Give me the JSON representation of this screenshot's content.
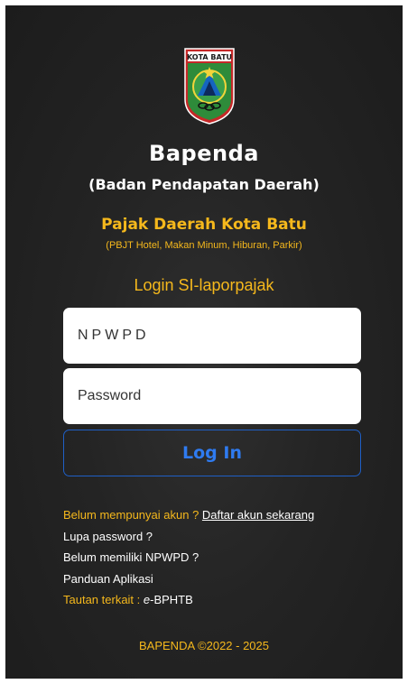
{
  "logo": {
    "text": "KOTA BATU"
  },
  "header": {
    "title": "Bapenda",
    "subtitle": "(Badan Pendapatan Daerah)",
    "tax_title": "Pajak Daerah Kota Batu",
    "tax_subtitle": "(PBJT Hotel, Makan Minum, Hiburan, Parkir)",
    "login_title": "Login SI-laporpajak"
  },
  "form": {
    "npwpd_placeholder": "NPWPD",
    "password_placeholder": "Password",
    "login_label": "Log In"
  },
  "links": {
    "no_account": "Belum mempunyai akun ? ",
    "register": "Daftar akun sekarang",
    "forgot": "Lupa password ?",
    "no_npwpd": "Belum memiliki NPWPD ?",
    "guide": "Panduan Aplikasi",
    "related_label": "Tautan terkait : ",
    "bphtb_prefix": "e",
    "bphtb_suffix": "-BPHTB"
  },
  "footer": {
    "copyright": "BAPENDA ©2022 - 2025"
  },
  "colors": {
    "background": "#222222",
    "gold": "#f5b81c",
    "button_border": "#1f5fc6",
    "button_text": "#2f7bf0"
  }
}
